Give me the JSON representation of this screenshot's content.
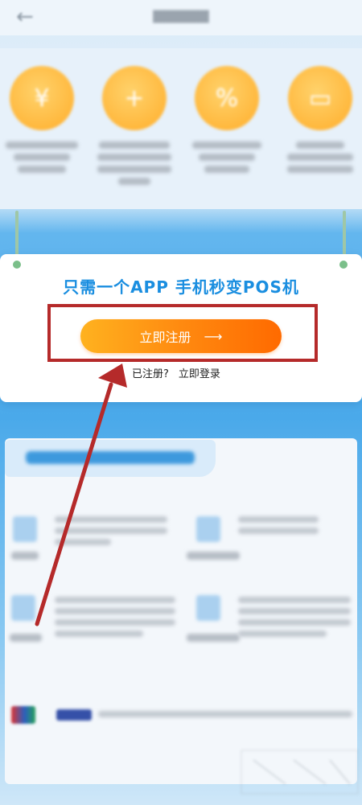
{
  "header": {
    "back_icon": "back-arrow-icon"
  },
  "features": {
    "icons": [
      "money-icon",
      "plus-icon",
      "percent-icon",
      "card-icon"
    ]
  },
  "promo": {
    "slogan": "只需一个APP  手机秒变POS机",
    "register_button_label": "立即注册",
    "register_arrow": "⟶",
    "already_registered": "已注册?",
    "login_link": "立即登录"
  },
  "annotation": {
    "highlight_color": "#b52a2a"
  },
  "colors": {
    "accent": "#1a8ee0",
    "button_start": "#ffb21f",
    "button_end": "#ff6a00"
  }
}
